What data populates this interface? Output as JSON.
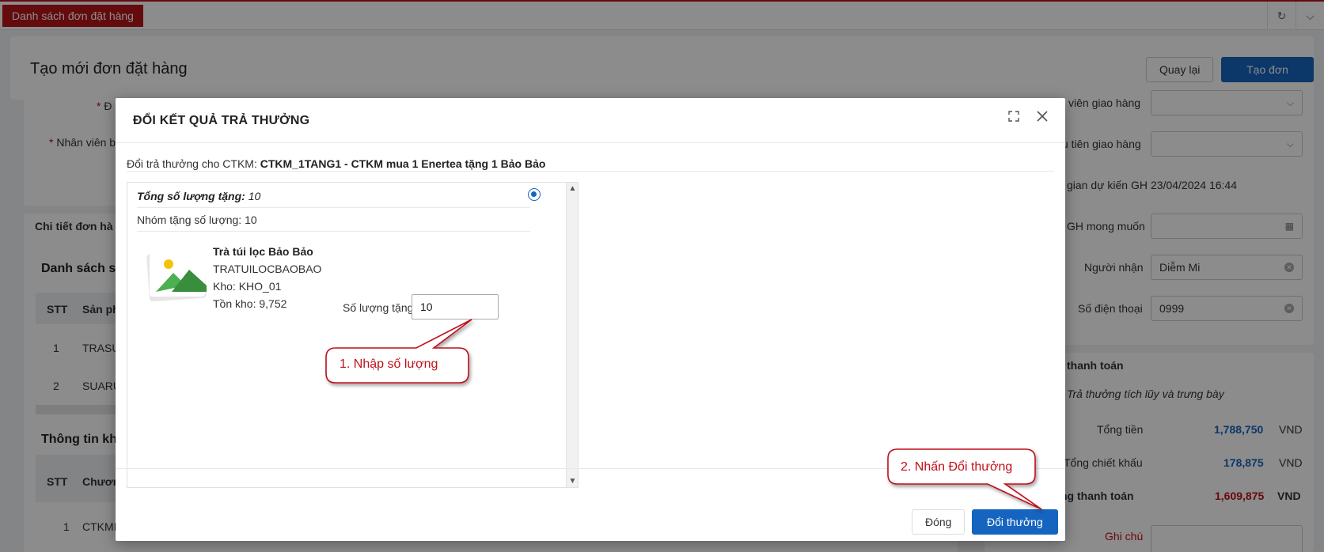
{
  "tabbar": {
    "active_tab": "Danh sách đơn đặt hàng",
    "refresh_icon": "refresh-icon",
    "collapse_icon": "chevron-down-icon"
  },
  "header": {
    "title": "Tạo mới đơn đặt hàng",
    "back_label": "Quay lại",
    "create_label": "Tạo đơn hàng"
  },
  "background": {
    "left_labels": {
      "field1": "Đ",
      "field2": "Nhân viên b"
    },
    "detail_section": "Chi tiết đơn hà",
    "product_list_title": "Danh sách s",
    "product_table": {
      "headers": [
        "STT",
        "Sản ph"
      ],
      "rows": [
        [
          "1",
          "TRASU"
        ],
        [
          "2",
          "SUARU"
        ]
      ]
    },
    "promo_info_title": "Thông tin kh",
    "promo_table": {
      "headers": [
        "STT",
        "Chươn"
      ],
      "rows": [
        [
          "1",
          "CTKMI"
        ]
      ]
    },
    "right_fields": {
      "delivery_staff_label": "viên giao hàng",
      "delivery_priority_label": "u tiên giao hàng",
      "expected_time_label": "gian dự kiến GH",
      "expected_time_value": "23/04/2024 16:44",
      "desired_date_label": "GH mong muốn",
      "receiver_label": "Người nhận",
      "receiver_value": "Diễm Mi",
      "phone_label": "Số điện thoại",
      "phone_value": "0999"
    },
    "payment": {
      "title": "thanh toán",
      "note": "Trả thưởng tích lũy và trưng bày",
      "total_label": "Tổng tiền",
      "total_value": "1,788,750",
      "total_unit": "VND",
      "discount_label": "Tổng chiết khấu",
      "discount_value": "178,875",
      "discount_unit": "VND",
      "pay_label": "ng thanh toán",
      "pay_value": "1,609,875",
      "pay_unit": "VND",
      "note_label": "Ghi chú"
    }
  },
  "modal": {
    "title": "ĐỔI KẾT QUẢ TRẢ THƯỞNG",
    "promo_prefix": "Đổi trả thưởng cho CTKM: ",
    "promo_name": "CTKM_1TANG1 - CTKM mua 1 Enertea tặng 1 Bảo Bảo",
    "total_gift_label": "Tổng số lượng tặng:",
    "total_gift_value": " 10",
    "group_label": "Nhóm tặng số lượng: 10",
    "product": {
      "name": "Trà túi lọc Bảo Bảo",
      "code": "TRATUILOCBAOBAO",
      "warehouse": "Kho: KHO_01",
      "stock": "Tồn kho: 9,752"
    },
    "qty_label": "Số lượng tặng:",
    "qty_value": "10",
    "close_label": "Đóng",
    "redeem_label": "Đổi thưởng"
  },
  "callouts": {
    "step1": "1. Nhập số lượng",
    "step2": "2. Nhấn Đổi thưởng"
  },
  "colors": {
    "brand_red": "#b7141b",
    "primary_blue": "#1565c0",
    "callout_red": "#c0111a"
  }
}
